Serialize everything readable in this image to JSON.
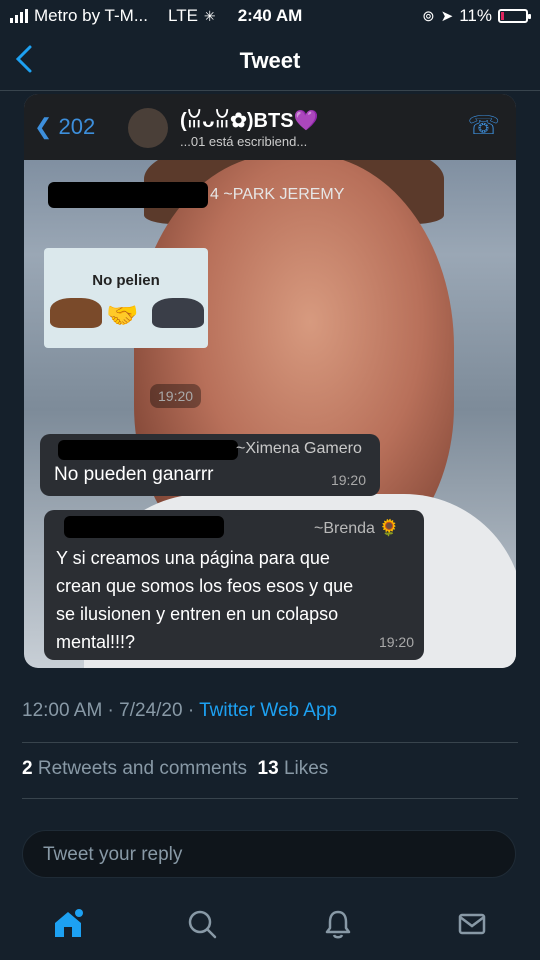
{
  "status_bar": {
    "carrier": "Metro by T-M...",
    "network": "LTE",
    "time": "2:40 AM",
    "battery": "11%"
  },
  "nav": {
    "title": "Tweet"
  },
  "screenshot": {
    "chat_header": {
      "back_count": "202",
      "group_name": "(ꈍᴗꈍ✿)BTS💜",
      "typing": "...01 está escribiend..."
    },
    "messages": [
      {
        "sender": "~PARK JEREMY",
        "sender_prefix": "4",
        "time": "19:20",
        "sticker_text": "No pelien"
      },
      {
        "sender": "~Ximena Gamero",
        "text": "No pueden ganarrr",
        "time": "19:20"
      },
      {
        "sender": "~Brenda 🌻",
        "text_lines": [
          "Y si creamos una página para que",
          "crean que somos los feos esos y que",
          "se ilusionen y entren en un colapso",
          "mental!!!?"
        ],
        "time": "19:20"
      }
    ]
  },
  "tweet_meta": {
    "time": "12:00 AM",
    "date": "7/24/20",
    "source": "Twitter Web App"
  },
  "stats": {
    "retweets_count": "2",
    "retweets_label": "Retweets and comments",
    "likes_count": "13",
    "likes_label": "Likes"
  },
  "reply": {
    "placeholder": "Tweet your reply"
  },
  "tabbar": {
    "icons": [
      "home-icon",
      "search-icon",
      "notifications-icon",
      "messages-icon"
    ]
  },
  "colors": {
    "background": "#15202b",
    "accent": "#1da1f2",
    "muted": "#8899a6"
  }
}
